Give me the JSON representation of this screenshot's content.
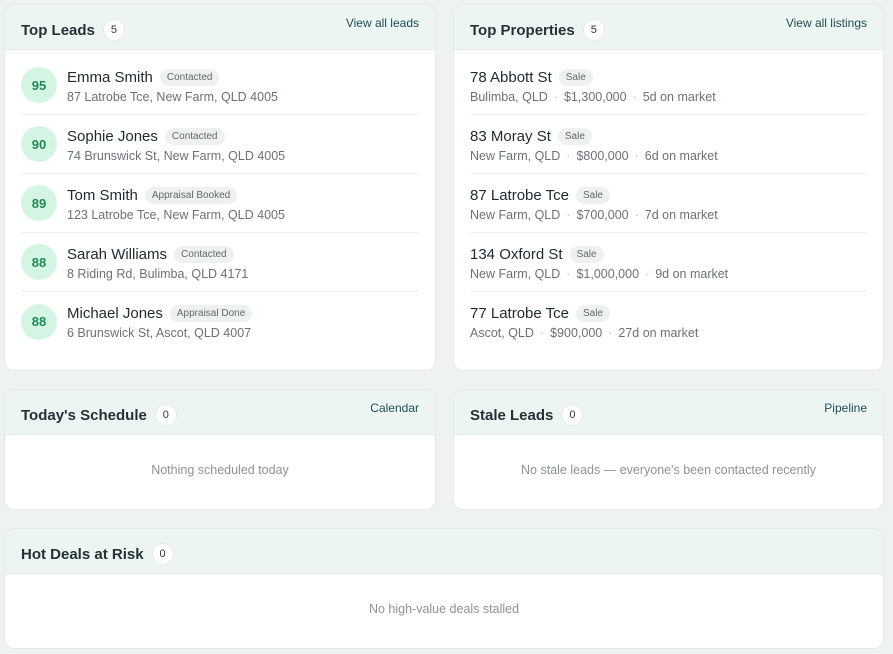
{
  "top_leads": {
    "title": "Top Leads",
    "count": "5",
    "link": "View all leads",
    "items": [
      {
        "score": "95",
        "name": "Emma Smith",
        "status": "Contacted",
        "address": "87 Latrobe Tce, New Farm, QLD 4005"
      },
      {
        "score": "90",
        "name": "Sophie Jones",
        "status": "Contacted",
        "address": "74 Brunswick St, New Farm, QLD 4005"
      },
      {
        "score": "89",
        "name": "Tom Smith",
        "status": "Appraisal Booked",
        "address": "123 Latrobe Tce, New Farm, QLD 4005"
      },
      {
        "score": "88",
        "name": "Sarah Williams",
        "status": "Contacted",
        "address": "8 Riding Rd, Bulimba, QLD 4171"
      },
      {
        "score": "88",
        "name": "Michael Jones",
        "status": "Appraisal Done",
        "address": "6 Brunswick St, Ascot, QLD 4007"
      }
    ]
  },
  "top_properties": {
    "title": "Top Properties",
    "count": "5",
    "link": "View all listings",
    "items": [
      {
        "address": "78 Abbott St",
        "type": "Sale",
        "suburb": "Bulimba, QLD",
        "price": "$1,300,000",
        "days": "5d on market"
      },
      {
        "address": "83 Moray St",
        "type": "Sale",
        "suburb": "New Farm, QLD",
        "price": "$800,000",
        "days": "6d on market"
      },
      {
        "address": "87 Latrobe Tce",
        "type": "Sale",
        "suburb": "New Farm, QLD",
        "price": "$700,000",
        "days": "7d on market"
      },
      {
        "address": "134 Oxford St",
        "type": "Sale",
        "suburb": "New Farm, QLD",
        "price": "$1,000,000",
        "days": "9d on market"
      },
      {
        "address": "77 Latrobe Tce",
        "type": "Sale",
        "suburb": "Ascot, QLD",
        "price": "$900,000",
        "days": "27d on market"
      }
    ]
  },
  "schedule": {
    "title": "Today's Schedule",
    "count": "0",
    "link": "Calendar",
    "empty": "Nothing scheduled today"
  },
  "stale_leads": {
    "title": "Stale Leads",
    "count": "0",
    "link": "Pipeline",
    "empty": "No stale leads — everyone's been contacted recently"
  },
  "hot_deals": {
    "title": "Hot Deals at Risk",
    "count": "0",
    "empty": "No high-value deals stalled"
  },
  "theme": {
    "score_bg": "#d5f5e4",
    "score_text": "#1f8a55",
    "header_bg": "#edf5f3"
  }
}
